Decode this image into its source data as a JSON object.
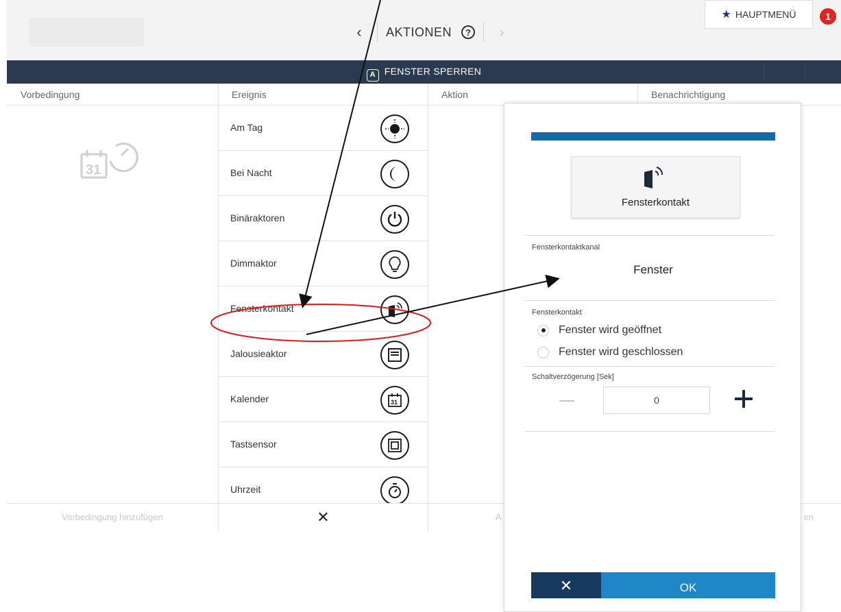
{
  "header": {
    "title": "AKTIONEN",
    "help_icon": "question-circle-icon",
    "back_icon": "chevron-left-icon",
    "forward_icon": "chevron-right-icon",
    "main_menu_label": "HAUPTMENÜ",
    "main_menu_icon": "star-icon",
    "notification_count": "1"
  },
  "action_bar": {
    "title": "FENSTER SPERREN",
    "icon": "automation-a-icon"
  },
  "columns": [
    "Vorbedingung",
    "Ereignis",
    "Aktion",
    "Benachrichtigung"
  ],
  "events": [
    {
      "label": "Am Tag",
      "icon": "sun-icon"
    },
    {
      "label": "Bei Nacht",
      "icon": "moon-icon"
    },
    {
      "label": "Binäraktoren",
      "icon": "power-icon"
    },
    {
      "label": "Dimmaktor",
      "icon": "lightbulb-icon"
    },
    {
      "label": "Fensterkontakt",
      "icon": "window-contact-icon"
    },
    {
      "label": "Jalousieaktor",
      "icon": "blind-icon"
    },
    {
      "label": "Kalender",
      "icon": "calendar-icon"
    },
    {
      "label": "Tastsensor",
      "icon": "push-button-icon"
    },
    {
      "label": "Uhrzeit",
      "icon": "timer-icon"
    }
  ],
  "footer": {
    "add_precondition": "Vorbedingung hinzufügen",
    "action_partial": "A",
    "notification_partial": "en",
    "close_icon": "close-icon"
  },
  "dialog": {
    "device_label": "Fensterkontakt",
    "device_icon": "window-contact-icon",
    "channel_label": "Fensterkontaktkanal",
    "channel_value": "Fenster",
    "state_label": "Fensterkontakt",
    "options": [
      {
        "label": "Fenster wird geöffnet",
        "selected": true
      },
      {
        "label": "Fenster wird geschlossen",
        "selected": false
      }
    ],
    "delay_label": "Schaltverzögerung [Sek]",
    "delay_value": "0",
    "cancel_icon": "close-icon",
    "ok_label": "OK"
  },
  "colors": {
    "dark_bar": "#2b3a4e",
    "dialog_accent": "#1469a6",
    "ok_button": "#1f87c8",
    "cancel_button": "#183a5e",
    "badge": "#e32424",
    "annotation": "#e01818"
  }
}
